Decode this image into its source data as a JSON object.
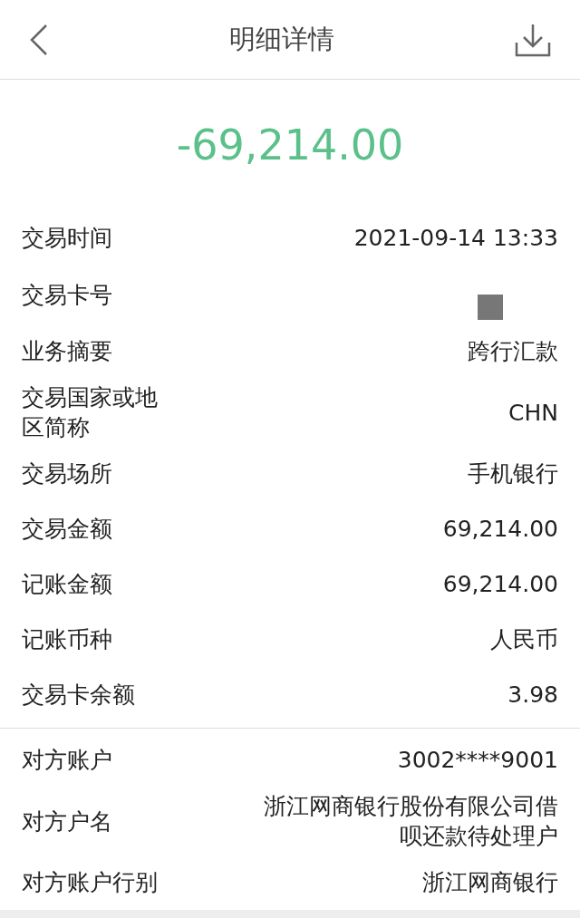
{
  "header": {
    "title": "明细详情"
  },
  "amount": "-69,214.00",
  "sections": [
    {
      "rows": [
        {
          "kind": "text",
          "label": "交易时间",
          "value": "2021-09-14 13:33"
        },
        {
          "kind": "redacted",
          "label": "交易卡号"
        },
        {
          "kind": "text",
          "label": "业务摘要",
          "value": "跨行汇款"
        },
        {
          "kind": "text",
          "label": "交易国家或地区简称",
          "value": "CHN"
        },
        {
          "kind": "text",
          "label": "交易场所",
          "value": "手机银行"
        },
        {
          "kind": "text",
          "label": "交易金额",
          "value": "69,214.00"
        },
        {
          "kind": "text",
          "label": "记账金额",
          "value": "69,214.00"
        },
        {
          "kind": "text",
          "label": "记账币种",
          "value": "人民币"
        },
        {
          "kind": "text",
          "label": "交易卡余额",
          "value": "3.98"
        }
      ]
    },
    {
      "rows": [
        {
          "kind": "text",
          "label": "对方账户",
          "value": "3002****9001"
        },
        {
          "kind": "text",
          "label": "对方户名",
          "value": "浙江网商银行股份有限公司借呗还款待处理户"
        },
        {
          "kind": "text",
          "label": "对方账户行别",
          "value": "浙江网商银行"
        }
      ]
    }
  ]
}
